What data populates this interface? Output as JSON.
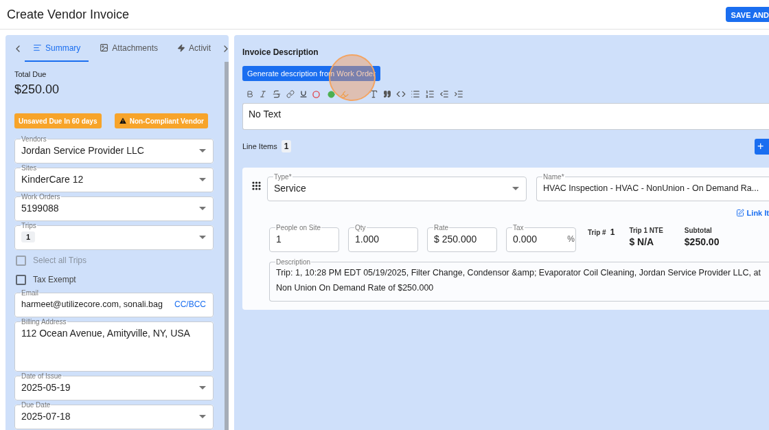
{
  "header": {
    "title": "Create Vendor Invoice",
    "save_button": "SAVE AND"
  },
  "left_panel": {
    "tabs": [
      {
        "label": "Summary",
        "selected": true
      },
      {
        "label": "Attachments",
        "selected": false
      },
      {
        "label": "Activit",
        "selected": false
      }
    ],
    "total_due": {
      "label": "Total Due",
      "value": "$250.00"
    },
    "badges": [
      {
        "label": "Unsaved Due In 60 days",
        "kind": "plain"
      },
      {
        "label": "Non-Compliant Vendor",
        "kind": "warning"
      }
    ],
    "form": [
      {
        "kind": "select",
        "label": "Vendors",
        "value": "Jordan Service Provider LLC"
      },
      {
        "kind": "select",
        "label": "Sites",
        "value": "KinderCare 12"
      },
      {
        "kind": "select",
        "label": "Work Orders",
        "value": "5199088"
      },
      {
        "kind": "chips",
        "label": "Trips",
        "chips": [
          "1"
        ]
      },
      {
        "kind": "checkbox",
        "label": "Select all Trips",
        "checked": false,
        "disabled": true
      },
      {
        "kind": "checkbox",
        "label": "Tax Exempt",
        "checked": false,
        "disabled": false
      },
      {
        "kind": "email",
        "label": "Email",
        "value": "harmeet@utilizecore.com, sonali.bag",
        "action": "CC/BCC"
      },
      {
        "kind": "textarea",
        "label": "Billing Address",
        "value": "112 Ocean Avenue, Amityville, NY, USA"
      },
      {
        "kind": "select",
        "label": "Date of Issue",
        "value": "2025-05-19"
      },
      {
        "kind": "select",
        "label": "Due Date",
        "value": "2025-07-18"
      }
    ]
  },
  "invoice_description": {
    "title": "Invoice Description",
    "generate_button": "Generate description from Work Order",
    "editor_text": "No Text"
  },
  "line_items": {
    "label": "Line Items",
    "count": "1",
    "add_button": "+",
    "items": [
      {
        "type": {
          "label": "Type*",
          "value": "Service"
        },
        "name": {
          "label": "Name*",
          "value": "HVAC Inspection - HVAC - NonUnion - On Demand Ra..."
        },
        "link": "Link It",
        "inputs": [
          {
            "label": "People on Site",
            "value": "1"
          },
          {
            "label": "Qty",
            "value": "1.000"
          },
          {
            "label": "Rate",
            "value": "$ 250.000"
          },
          {
            "label": "Tax",
            "value": "0.000",
            "suffix": "%"
          }
        ],
        "trip": {
          "label": "Trip #",
          "value": "1"
        },
        "nte": {
          "label": "Trip 1 NTE",
          "value": "$ N/A"
        },
        "subtotal": {
          "label": "Subtotal",
          "value": "$250.00"
        },
        "description": {
          "label": "Description",
          "lines": [
            "Trip: 1, 10:28 PM EDT 05/19/2025, Filter Change, Condensor &amp; Evaporator Coil Cleaning, Jordan Service Provider LLC, at",
            "Non Union On Demand Rate of $250.000"
          ]
        }
      }
    ]
  }
}
